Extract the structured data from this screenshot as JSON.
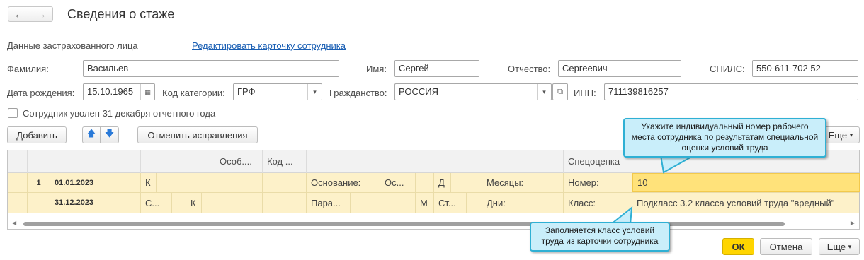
{
  "header": {
    "back_icon": "arrow-left-icon",
    "forward_icon": "arrow-right-icon",
    "title": "Сведения о стаже"
  },
  "section": {
    "insured_label": "Данные застрахованного лица",
    "edit_link": "Редактировать карточку сотрудника"
  },
  "person": {
    "surname_label": "Фамилия:",
    "surname": "Васильев",
    "name_label": "Имя:",
    "name": "Сергей",
    "patronymic_label": "Отчество:",
    "patronymic": "Сергеевич",
    "snils_label": "СНИЛС:",
    "snils": "550-611-702 52",
    "birth_label": "Дата рождения:",
    "birth": "15.10.1965",
    "category_label": "Код категории:",
    "category": "ГРФ",
    "citizenship_label": "Гражданство:",
    "citizenship": "РОССИЯ",
    "inn_label": "ИНН:",
    "inn": "711139816257",
    "dismissed_label": "Сотрудник уволен 31 декабря отчетного года"
  },
  "toolbar": {
    "add": "Добавить",
    "cancel_corrections": "Отменить исправления",
    "more": "Еще"
  },
  "table": {
    "headers": {
      "col_spec": "Особ....",
      "col_code": "Код ...",
      "col_special": "Спецоценка"
    },
    "row1": {
      "num": "1",
      "date_from": "01.01.2023",
      "c_k1": "К",
      "basis_label": "Основание:",
      "os": "Ос...",
      "d": "Д",
      "months_label": "Месяцы:",
      "number_label": "Номер:",
      "number_value": "10"
    },
    "row2": {
      "date_to": "31.12.2023",
      "c_s": "С...",
      "c_k2": "К",
      "param_label": "Пара...",
      "m": "М",
      "st": "Ст...",
      "days_label": "Дни:",
      "class_label": "Класс:",
      "class_value": "Подкласс 3.2 класса условий труда \"вредный\""
    }
  },
  "callouts": {
    "number_hint": "Укажите индивидуальный номер рабочего места сотрудника по результатам специальной оценки условий труда",
    "class_hint": "Заполняется класс условий труда из карточки сотрудника"
  },
  "footer": {
    "ok": "ОК",
    "cancel": "Отмена",
    "more": "Еще"
  },
  "colors": {
    "row_highlight": "#fdf1c9",
    "active_cell": "#ffe27a",
    "ok_button": "#ffd500",
    "callout_fill": "#c9eefa",
    "callout_border": "#2fb0d4",
    "link": "#1a5fb4"
  }
}
